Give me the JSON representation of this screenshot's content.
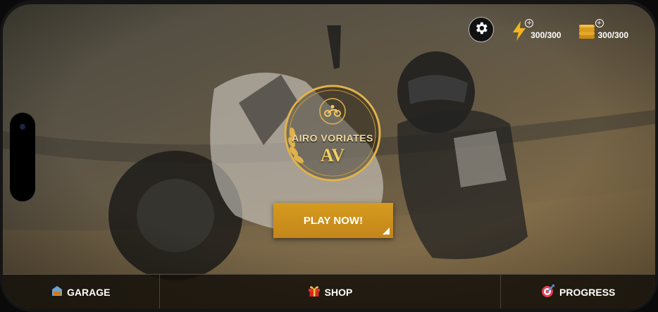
{
  "resources": {
    "energy": {
      "icon": "lightning-icon",
      "value": "300/300",
      "plus": "+"
    },
    "coins": {
      "icon": "coin-stack-icon",
      "value": "300/300",
      "plus": "+"
    }
  },
  "settings": {
    "icon": "gear-icon"
  },
  "logo": {
    "title": "AIRO VORIATES",
    "mark": "AV",
    "icon": "motorcycle-icon"
  },
  "play_button": {
    "label": "PLAY NOW!"
  },
  "bottom_nav": {
    "garage": {
      "label": "GARAGE",
      "icon": "garage-icon"
    },
    "shop": {
      "label": "SHOP",
      "icon": "gift-icon"
    },
    "progress": {
      "label": "PROGRESS",
      "icon": "target-icon"
    }
  },
  "colors": {
    "accent": "#c98f1c",
    "gold": "#e0b24a"
  }
}
